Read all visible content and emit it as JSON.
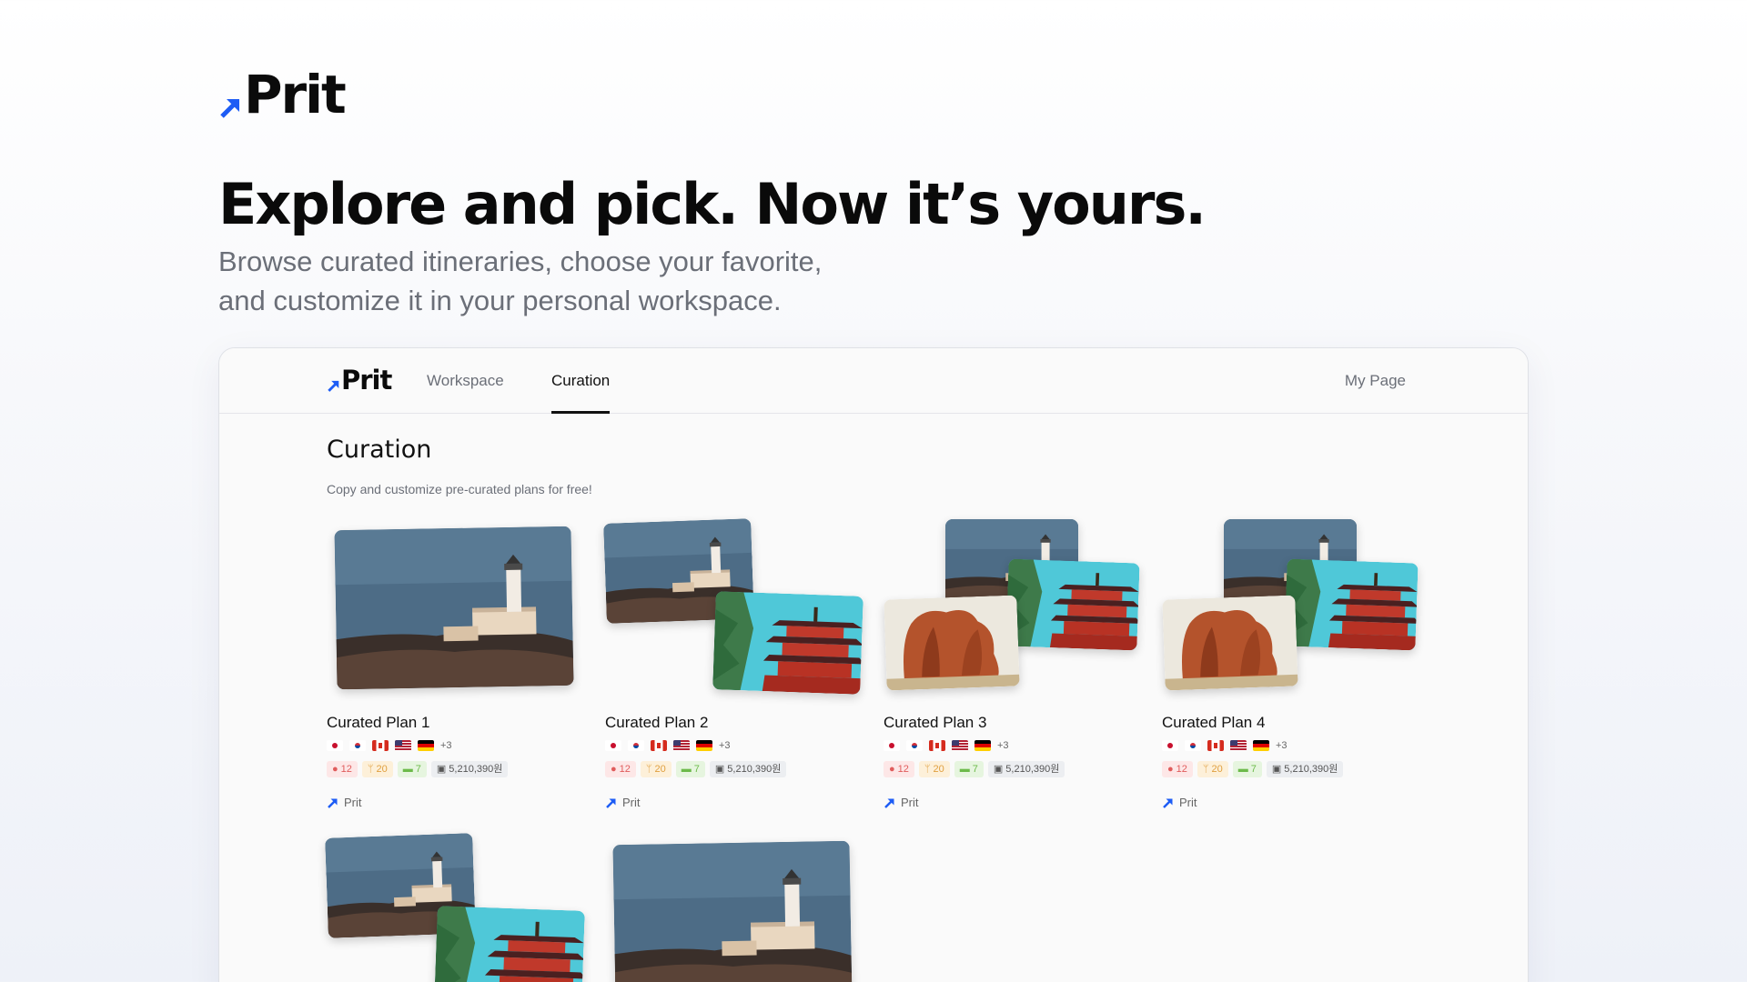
{
  "brand": {
    "name": "Prit",
    "accent": "#1d5cf5"
  },
  "hero": {
    "title": "Explore and pick. Now it’s yours.",
    "subtitle_line1": "Browse curated itineraries, choose your favorite,",
    "subtitle_line2": "and customize it in your personal workspace."
  },
  "nav": {
    "tabs": [
      {
        "label": "Workspace",
        "active": false
      },
      {
        "label": "Curation",
        "active": true
      }
    ],
    "my_page": "My Page"
  },
  "page": {
    "title": "Curation",
    "subtitle": "Copy and customize pre-curated plans for free!"
  },
  "plans": [
    {
      "title": "Curated Plan 1",
      "more_flags": "+3",
      "places": "12",
      "restaurants": "20",
      "stays": "7",
      "budget": "5,210,390원",
      "author": "Prit"
    },
    {
      "title": "Curated Plan 2",
      "more_flags": "+3",
      "places": "12",
      "restaurants": "20",
      "stays": "7",
      "budget": "5,210,390원",
      "author": "Prit"
    },
    {
      "title": "Curated Plan 3",
      "more_flags": "+3",
      "places": "12",
      "restaurants": "20",
      "stays": "7",
      "budget": "5,210,390원",
      "author": "Prit"
    },
    {
      "title": "Curated Plan 4",
      "more_flags": "+3",
      "places": "12",
      "restaurants": "20",
      "stays": "7",
      "budget": "5,210,390원",
      "author": "Prit"
    }
  ],
  "icons": {
    "places": "map-pin-icon",
    "restaurants": "utensils-icon",
    "stays": "bed-icon",
    "budget": "money-icon"
  }
}
